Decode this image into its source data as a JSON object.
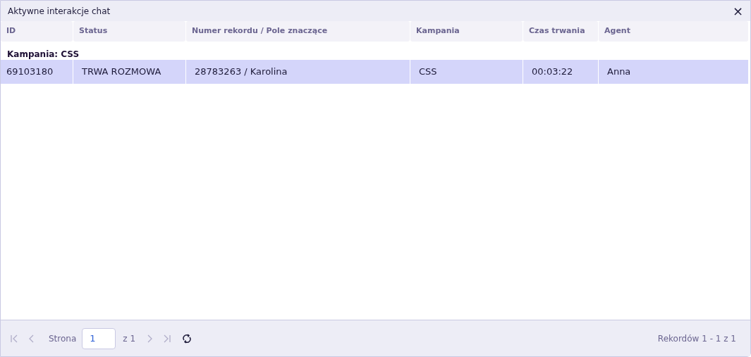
{
  "window": {
    "title": "Aktywne interakcje chat",
    "close": "×"
  },
  "table": {
    "columns": [
      "ID",
      "Status",
      "Numer rekordu / Pole znaczące",
      "Kampania",
      "Czas trwania",
      "Agent"
    ],
    "groups": [
      {
        "label": "Kampania: CSS",
        "rows": [
          {
            "cells": [
              "69103180",
              "TRWA ROZMOWA",
              "28783263 / Karolina",
              "CSS",
              "00:03:22",
              "Anna"
            ],
            "selected": true
          }
        ]
      }
    ]
  },
  "pager": {
    "first_disabled": true,
    "prev_disabled": true,
    "page_label": "Strona",
    "page": "1",
    "of": "z 1",
    "next_disabled": true,
    "last_disabled": true,
    "summary": "Rekordów 1 - 1 z 1"
  }
}
